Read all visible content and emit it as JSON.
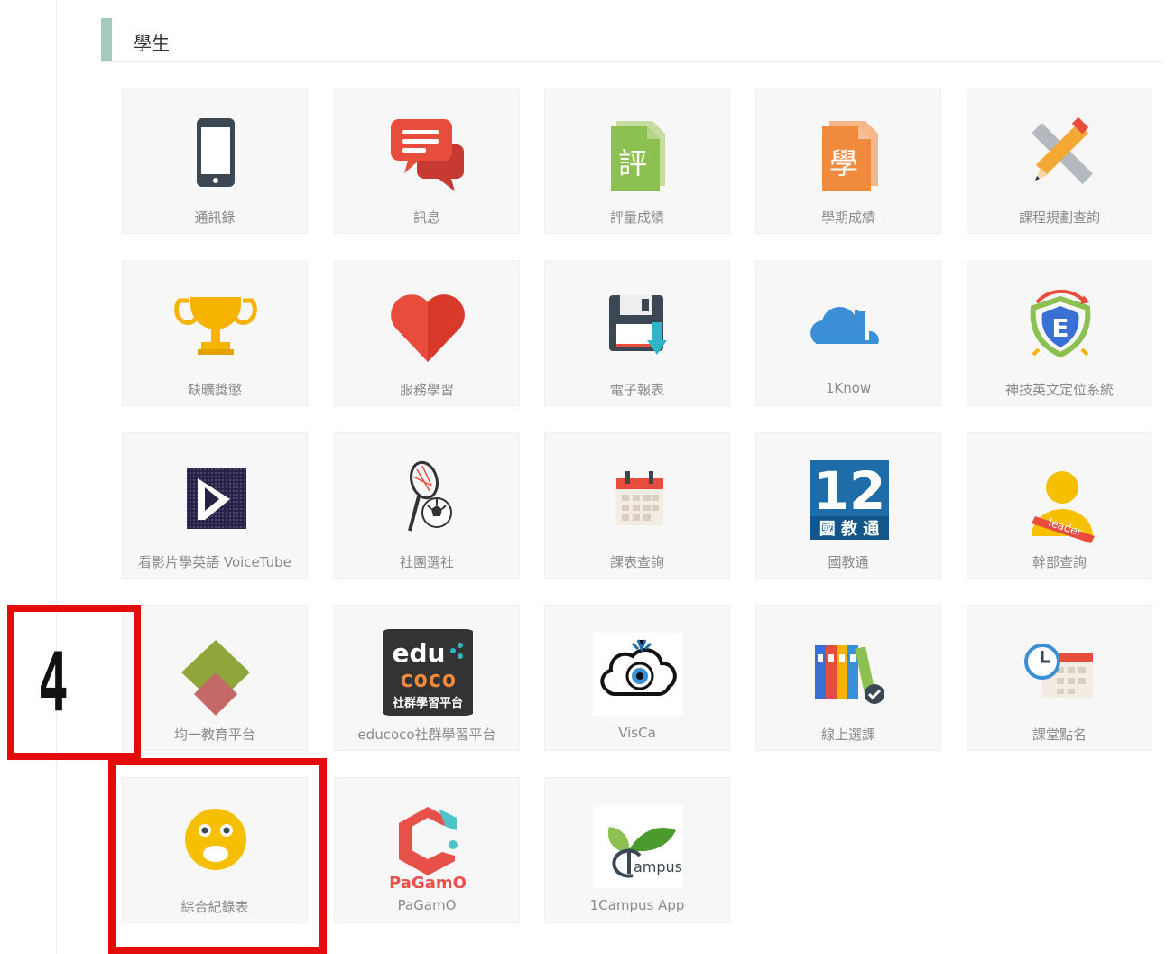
{
  "section": {
    "title": "學生"
  },
  "colors": {
    "section_accent": "#a6c9bb",
    "annotation": "#e30b0b"
  },
  "apps": [
    {
      "id": "contacts",
      "label": "通訊錄",
      "icon": "phone-icon"
    },
    {
      "id": "messages",
      "label": "訊息",
      "icon": "chat-bubbles-icon"
    },
    {
      "id": "assessment-grades",
      "label": "評量成績",
      "icon": "document-ping-icon",
      "icon_text": "評"
    },
    {
      "id": "semester-grades",
      "label": "學期成績",
      "icon": "document-xue-icon",
      "icon_text": "學"
    },
    {
      "id": "course-planning",
      "label": "課程規劃查詢",
      "icon": "pencil-ruler-icon"
    },
    {
      "id": "attendance-rewards",
      "label": "缺曠獎懲",
      "icon": "trophy-icon"
    },
    {
      "id": "service-learning",
      "label": "服務學習",
      "icon": "heart-icon"
    },
    {
      "id": "e-report",
      "label": "電子報表",
      "icon": "floppy-download-icon"
    },
    {
      "id": "1know",
      "label": "1Know",
      "icon": "cloud-icon"
    },
    {
      "id": "english-placement",
      "label": "神技英文定位系統",
      "icon": "e-shield-icon"
    },
    {
      "id": "voicetube",
      "label": "看影片學英語 VoiceTube",
      "icon": "voicetube-icon"
    },
    {
      "id": "club-selection",
      "label": "社團選社",
      "icon": "racket-ball-icon"
    },
    {
      "id": "timetable",
      "label": "課表查詢",
      "icon": "calendar-icon"
    },
    {
      "id": "national-education",
      "label": "國教通",
      "icon": "twelve-badge-icon",
      "icon_text_top": "12",
      "icon_text_bottom": "國 教 通"
    },
    {
      "id": "cadre-query",
      "label": "幹部查詢",
      "icon": "leader-icon",
      "icon_text": "leader"
    },
    {
      "id": "junyi",
      "label": "均一教育平台",
      "icon": "junyi-diamond-icon"
    },
    {
      "id": "educoco",
      "label": "educoco社群學習平台",
      "icon": "educoco-icon",
      "icon_text_top": "edu",
      "icon_text_mid": "coco",
      "icon_text_bottom": "社群學習平台"
    },
    {
      "id": "visca",
      "label": "VisCa",
      "icon": "eye-cloud-icon"
    },
    {
      "id": "online-course-selection",
      "label": "線上選課",
      "icon": "binders-icon"
    },
    {
      "id": "class-roll-call",
      "label": "課堂點名",
      "icon": "clock-calendar-icon"
    },
    {
      "id": "comprehensive-record",
      "label": "綜合紀錄表",
      "icon": "face-icon"
    },
    {
      "id": "pagamo",
      "label": "PaGamO",
      "icon": "pagamo-icon",
      "icon_text": "PaGamO"
    },
    {
      "id": "1campus-app",
      "label": "1Campus App",
      "icon": "campus-sprout-icon",
      "icon_text": "ampus"
    }
  ],
  "annotation": {
    "number": "4"
  }
}
